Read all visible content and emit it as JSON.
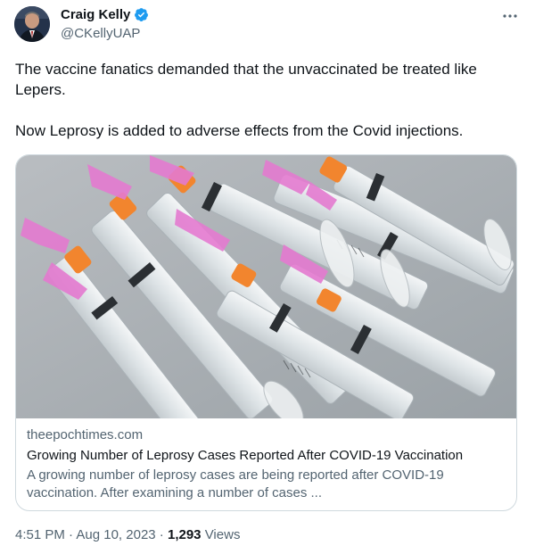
{
  "author": {
    "name": "Craig Kelly",
    "handle": "@CKellyUAP",
    "verified_badge": "verified-icon"
  },
  "tweet": {
    "text": "The vaccine fanatics demanded that the unvaccinated be treated like Lepers.\n\nNow Leprosy is added to adverse effects from the Covid injections."
  },
  "link_card": {
    "image_description_icon": "syringes-photo",
    "domain": "theepochtimes.com",
    "title": "Growing Number of Leprosy Cases Reported After COVID-19 Vaccination",
    "description": "A growing number of leprosy cases are being reported after COVID-19 vaccination. After examining a number of cases ..."
  },
  "meta": {
    "time": "4:51 PM",
    "separator1": " · ",
    "date": "Aug 10, 2023",
    "separator2": " · ",
    "views_count": "1,293",
    "views_label": " Views"
  },
  "colors": {
    "text_primary": "#0f1419",
    "text_secondary": "#536471",
    "verified": "#1d9bf0",
    "border": "#cfd9de"
  }
}
